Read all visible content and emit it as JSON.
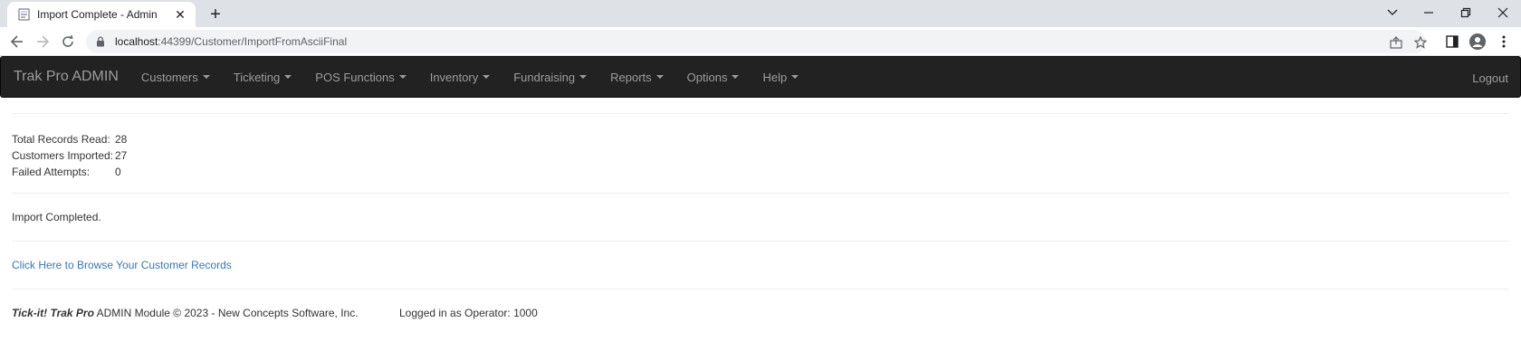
{
  "browser": {
    "tab_title": "Import Complete - Admin",
    "new_tab": "+",
    "url_host": "localhost",
    "url_path": ":44399/Customer/ImportFromAsciiFinal"
  },
  "navbar": {
    "brand": "Trak Pro ADMIN",
    "items": [
      {
        "label": "Customers"
      },
      {
        "label": "Ticketing"
      },
      {
        "label": "POS Functions"
      },
      {
        "label": "Inventory"
      },
      {
        "label": "Fundraising"
      },
      {
        "label": "Reports"
      },
      {
        "label": "Options"
      },
      {
        "label": "Help"
      }
    ],
    "logout": "Logout"
  },
  "stats": {
    "total_label": "Total Records Read:",
    "total_value": "28",
    "imported_label": "Customers Imported:",
    "imported_value": "27",
    "failed_label": "Failed Attempts:",
    "failed_value": "0"
  },
  "message": "Import Completed.",
  "browse_link": "Click Here to Browse Your Customer Records",
  "footer": {
    "product": "Tick-it! Trak Pro",
    "rest": " ADMIN Module © 2023 - New Concepts Software, Inc.",
    "operator": "Logged in as Operator: 1000"
  },
  "colors": {
    "navbar_bg": "#222222",
    "link": "#337ab7"
  }
}
